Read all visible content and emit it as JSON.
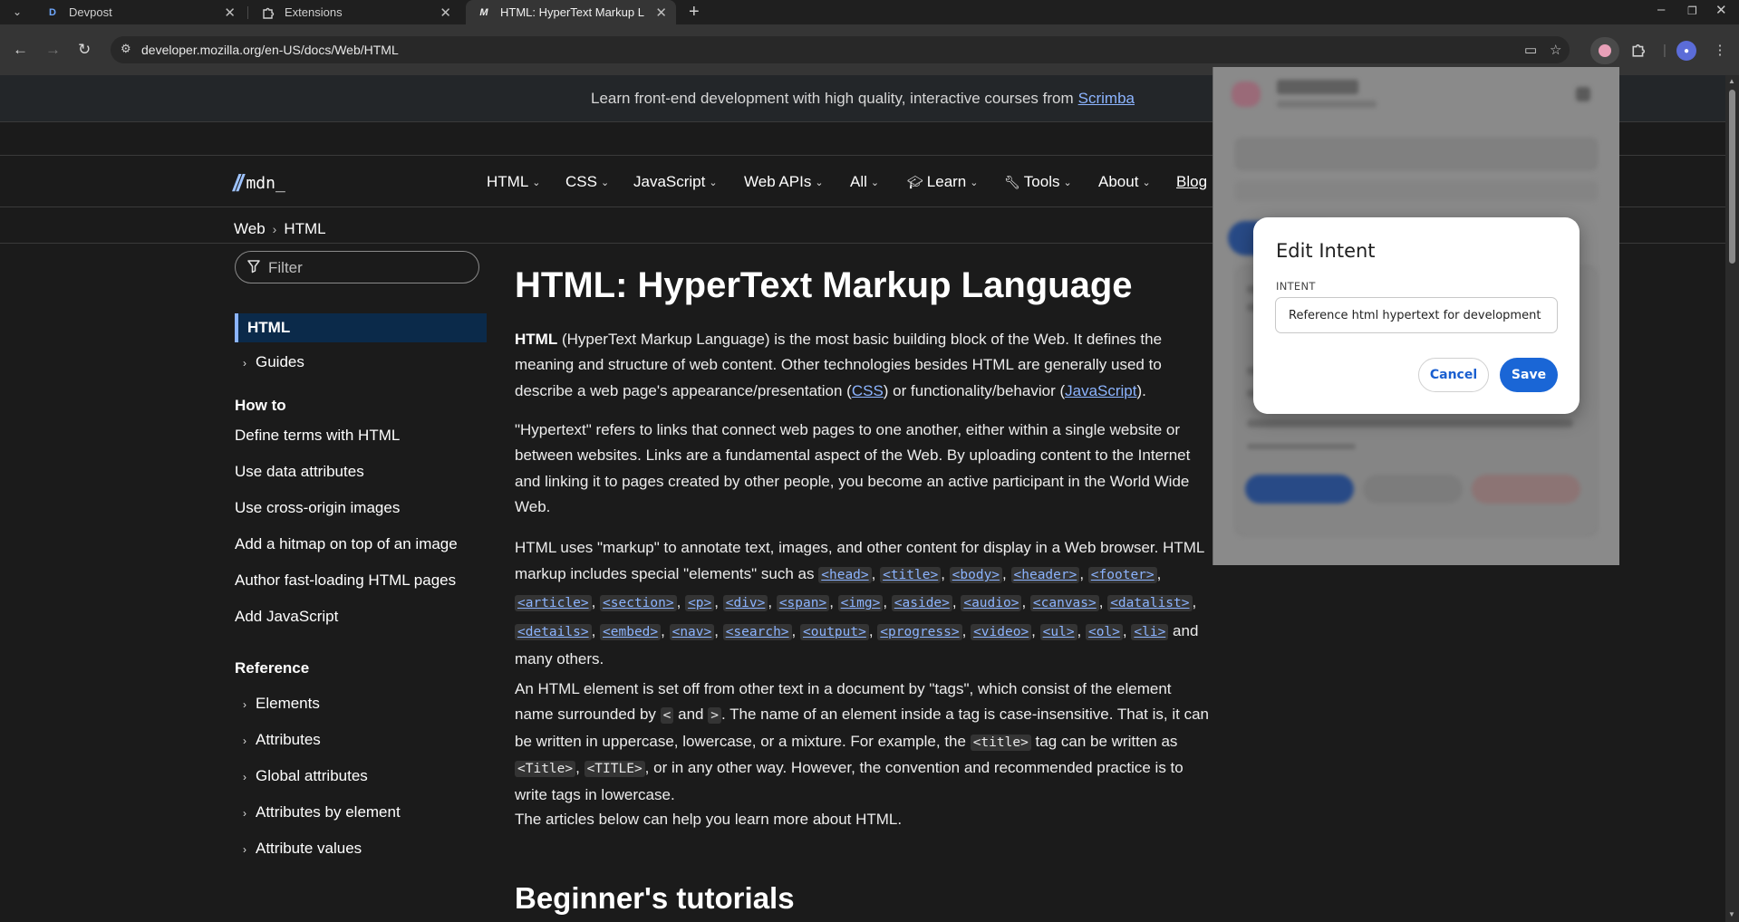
{
  "browser": {
    "tabs": [
      {
        "label": "Devpost",
        "favicon": "D"
      },
      {
        "label": "Extensions",
        "favicon": "puzzle-icon"
      },
      {
        "label": "HTML: HyperText Markup L",
        "favicon": "M"
      }
    ],
    "url": "developer.mozilla.org/en-US/docs/Web/HTML"
  },
  "banner": {
    "text": "Learn front-end development with high quality, interactive courses from",
    "link": "Scrimba"
  },
  "nav": {
    "logo_text": "mdn_",
    "items": [
      "HTML",
      "CSS",
      "JavaScript",
      "Web APIs",
      "All",
      "Learn",
      "Tools",
      "About"
    ],
    "blog": "Blog"
  },
  "breadcrumb": [
    "Web",
    "HTML"
  ],
  "sidebar": {
    "filter_placeholder": "Filter",
    "active": "HTML",
    "guides": "Guides",
    "howto_heading": "How to",
    "howto": [
      "Define terms with HTML",
      "Use data attributes",
      "Use cross-origin images",
      "Add a hitmap on top of an image",
      "Author fast-loading HTML pages",
      "Add JavaScript"
    ],
    "reference_heading": "Reference",
    "reference": [
      "Elements",
      "Attributes",
      "Global attributes",
      "Attributes by element",
      "Attribute values"
    ]
  },
  "main": {
    "title": "HTML: HyperText Markup Language",
    "p1_bold": "HTML",
    "p1_text": " (HyperText Markup Language) is the most basic building block of the Web. It defines the meaning and structure of web content. Other technologies besides HTML are generally used to describe a web page's appearance/presentation (",
    "p1_css": "CSS",
    "p1_mid": ") or functionality/behavior (",
    "p1_js": "JavaScript",
    "p1_end": ").",
    "p2": "\"Hypertext\" refers to links that connect web pages to one another, either within a single website or between websites. Links are a fundamental aspect of the Web. By uploading content to the Internet and linking it to pages created by other people, you become an active participant in the World Wide Web.",
    "p3_start": "HTML uses \"markup\" to annotate text, images, and other content for display in a Web browser. HTML markup includes special \"elements\" such as",
    "p3_tags": [
      "<head>",
      "<title>",
      "<body>",
      "<header>",
      "<footer>",
      "<article>",
      "<section>",
      "<p>",
      "<div>",
      "<span>",
      "<img>",
      "<aside>",
      "<audio>",
      "<canvas>",
      "<datalist>",
      "<details>",
      "<embed>",
      "<nav>",
      "<search>",
      "<output>",
      "<progress>",
      "<video>",
      "<ul>",
      "<ol>",
      "<li>"
    ],
    "p3_end": "and many others.",
    "p4_a": "An HTML element is set off from other text in a document by \"tags\", which consist of the element name surrounded by",
    "p4_lt": "<",
    "p4_and": "and",
    "p4_gt": ">",
    "p4_b": ". The name of an element inside a tag is case-insensitive. That is, it can be written in uppercase, lowercase, or a mixture. For example, the",
    "p4_title": "<title>",
    "p4_c": "tag can be written as",
    "p4_t1": "<Title>",
    "p4_t2": "<TITLE>",
    "p4_d": ", or in any other way. However, the convention and recommended practice is to write tags in lowercase.",
    "p5": "The articles below can help you learn more about HTML.",
    "h2": "Beginner's tutorials"
  },
  "modal": {
    "title": "Edit Intent",
    "label": "INTENT",
    "value": "Reference html hypertext for development",
    "cancel": "Cancel",
    "save": "Save"
  },
  "colors": {
    "accent": "#1a66d6",
    "link": "#8cb4ff",
    "page_bg": "#1b1b1b"
  }
}
